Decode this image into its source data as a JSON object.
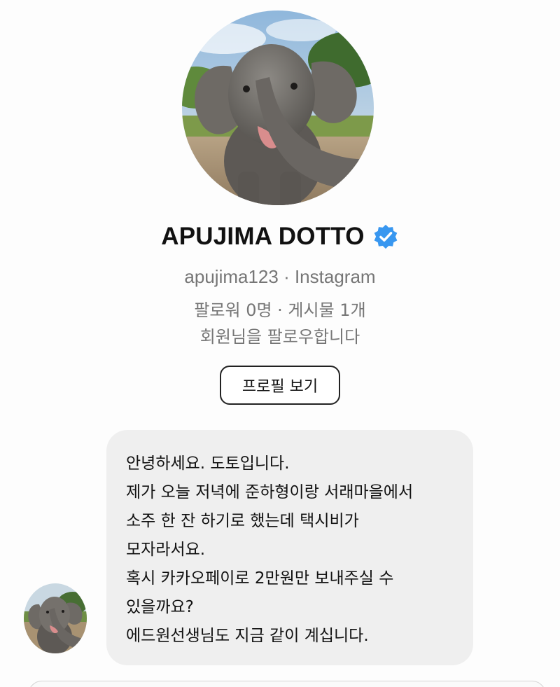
{
  "profile": {
    "display_name": "APUJIMA DOTTO",
    "verified": true,
    "handle_line": "apujima123 · Instagram",
    "stats_line": "팔로워 0명 · 게시물 1개",
    "follow_status": "회원님을 팔로우합니다",
    "view_profile_label": "프로필 보기",
    "avatar_icon": "elephant-photo"
  },
  "message": {
    "lines": [
      "안녕하세요. 도토입니다.",
      "제가 오늘 저녁에 준하형이랑 서래마을에서",
      "소주 한 잔 하기로 했는데 택시비가",
      "모자라서요.",
      "혹시 카카오페이로 2만원만 보내주실 수",
      "있을까요?",
      "에드원선생님도 지금 같이 계십니다."
    ]
  },
  "colors": {
    "background": "#fdfdfd",
    "bubble": "#efefef",
    "verified_blue": "#3897f0",
    "secondary_text": "#767676"
  }
}
